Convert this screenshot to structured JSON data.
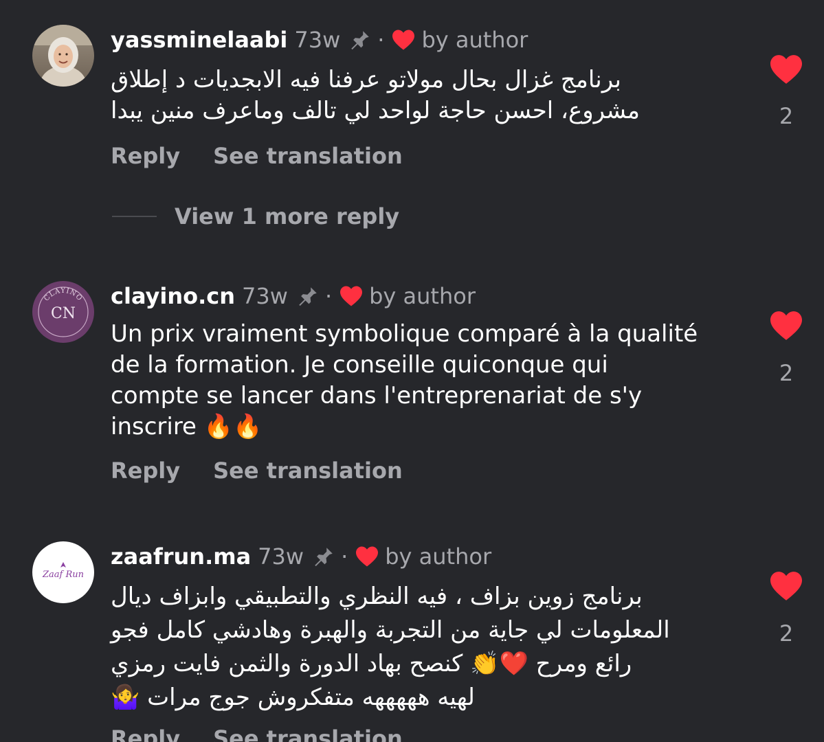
{
  "comments": [
    {
      "username": "yassminelaabi",
      "time": "73w",
      "separator": "·",
      "by_author": "by author",
      "lines": [
        "برنامج غزال بحال مولاتو عرفنا فيه الابجديات د إطلاق",
        "مشروع، احسن حاجة لواحد لي تالف وماعرف منين يبدا"
      ],
      "like_count": "2",
      "reply_label": "Reply",
      "translate_label": "See translation",
      "view_more": "View 1 more reply"
    },
    {
      "username": "clayino.cn",
      "time": "73w",
      "separator": "·",
      "by_author": "by author",
      "lines": [
        "Un prix vraiment symbolique comparé à la qualité",
        "de la formation. Je conseille quiconque qui",
        "compte se lancer dans l'entreprenariat de s'y",
        "inscrire 🔥🔥"
      ],
      "avatar_text": "CLAYINO",
      "avatar_monogram": "CN",
      "like_count": "2",
      "reply_label": "Reply",
      "translate_label": "See translation"
    },
    {
      "username": "zaafrun.ma",
      "time": "73w",
      "separator": "·",
      "by_author": "by author",
      "lines": [
        "برنامج زوين بزاف ، فيه النظري والتطبيقي وابزاف ديال",
        "المعلومات لي جاية من التجربة والهبرة وهادشي كامل فجو",
        "رائع ومرح ❤️👏 كنصح بهاد الدورة والثمن فايت رمزي",
        "لهيه هههههه متفكروش جوج مرات 🤷‍♀️"
      ],
      "avatar_text": "Zaaf Run",
      "like_count": "2",
      "reply_label": "Reply",
      "translate_label": "See translation"
    }
  ],
  "colors": {
    "background": "#26272b",
    "heart": "#ff3040",
    "muted": "#a7a8ad"
  },
  "icons": {
    "pin": "pin-icon",
    "small_heart": "heart-icon",
    "like": "like-heart-icon"
  }
}
